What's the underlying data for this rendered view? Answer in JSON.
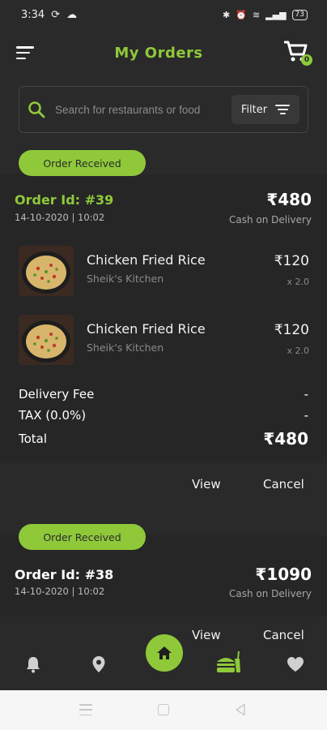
{
  "status_bar": {
    "time": "3:34",
    "battery": "73"
  },
  "header": {
    "title": "My Orders",
    "cart_count": "0"
  },
  "search": {
    "placeholder": "Search for restaurants or food",
    "filter_label": "Filter"
  },
  "orders": [
    {
      "status": "Order Received",
      "order_id": "Order Id: #39",
      "date": "14-10-2020 | 10:02",
      "price": "₹480",
      "payment": "Cash on Delivery",
      "items": [
        {
          "name": "Chicken Fried Rice",
          "restaurant": "Sheik's Kitchen",
          "price": "₹120",
          "qty": "x 2.0"
        },
        {
          "name": "Chicken Fried Rice",
          "restaurant": "Sheik's Kitchen",
          "price": "₹120",
          "qty": "x 2.0"
        }
      ],
      "delivery_fee_label": "Delivery Fee",
      "delivery_fee_value": "-",
      "tax_label": "TAX (0.0%)",
      "tax_value": "-",
      "total_label": "Total",
      "total_value": "₹480",
      "view_label": "View",
      "cancel_label": "Cancel"
    },
    {
      "status": "Order Received",
      "order_id": "Order Id: #38",
      "date": "14-10-2020 | 10:02",
      "price": "₹1090",
      "payment": "Cash on Delivery",
      "view_label": "View",
      "cancel_label": "Cancel"
    }
  ],
  "colors": {
    "accent": "#8fc93a",
    "background": "#2a2a2a",
    "card": "#262626"
  },
  "bottom_nav": [
    "bell-icon",
    "location-icon",
    "home-icon",
    "food-icon",
    "heart-icon"
  ]
}
